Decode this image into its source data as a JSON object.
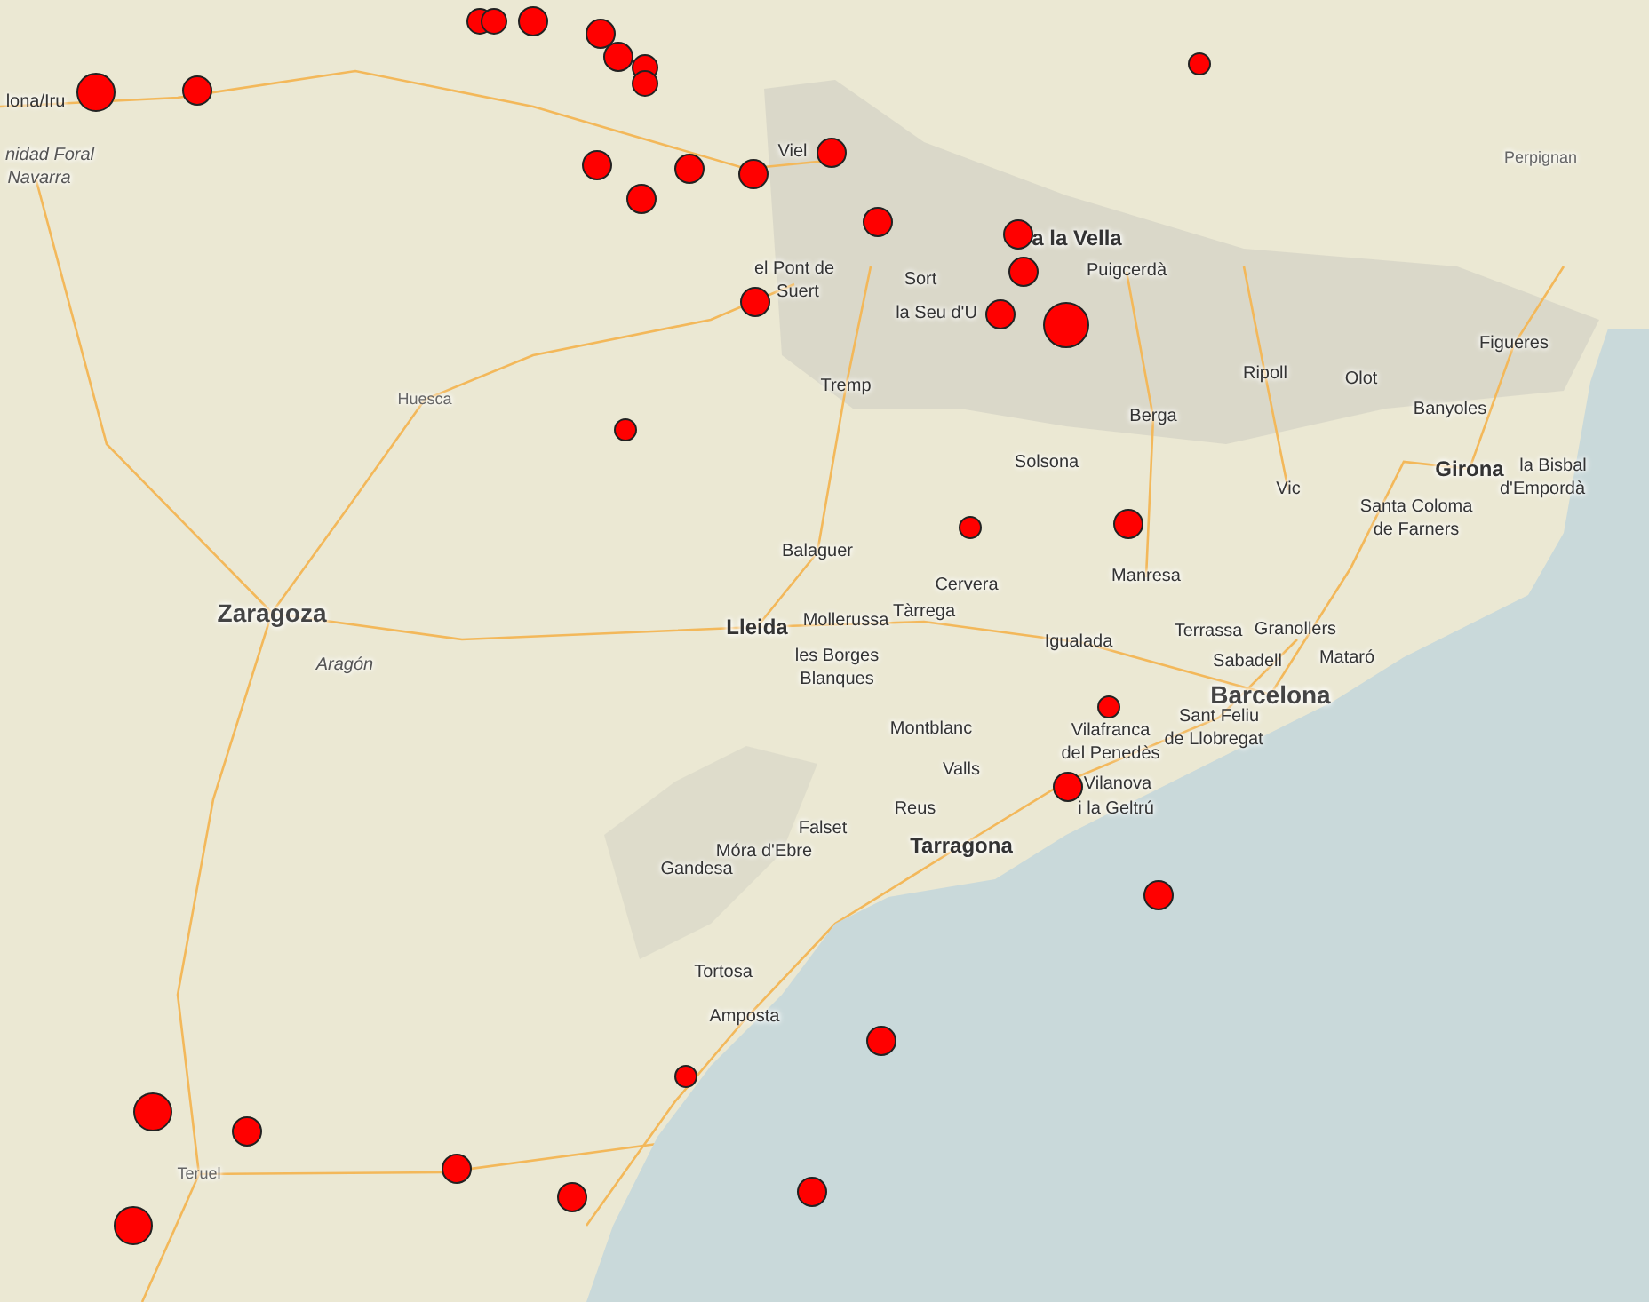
{
  "map": {
    "labels": [
      {
        "text": "lona/Iru",
        "kind": "town"
      },
      {
        "text": "nidad Foral",
        "kind": "region"
      },
      {
        "text": "Navarra",
        "kind": "region"
      },
      {
        "text": "Viel",
        "kind": "town"
      },
      {
        "text": "a la Vella",
        "kind": "city"
      },
      {
        "text": "el Pont de",
        "kind": "town"
      },
      {
        "text": "Suert",
        "kind": "town"
      },
      {
        "text": "Sort",
        "kind": "town"
      },
      {
        "text": "Puigcerdà",
        "kind": "town"
      },
      {
        "text": "la Seu d'U",
        "kind": "town"
      },
      {
        "text": "Perpignan",
        "kind": "faint"
      },
      {
        "text": "Figueres",
        "kind": "town"
      },
      {
        "text": "Tremp",
        "kind": "town"
      },
      {
        "text": "Ripoll",
        "kind": "town"
      },
      {
        "text": "Olot",
        "kind": "town"
      },
      {
        "text": "Banyoles",
        "kind": "town"
      },
      {
        "text": "Huesca",
        "kind": "faint"
      },
      {
        "text": "Berga",
        "kind": "town"
      },
      {
        "text": "Girona",
        "kind": "city"
      },
      {
        "text": "la Bisbal",
        "kind": "town"
      },
      {
        "text": "d'Empordà",
        "kind": "town"
      },
      {
        "text": "Solsona",
        "kind": "town"
      },
      {
        "text": "Vic",
        "kind": "town"
      },
      {
        "text": "Santa Coloma",
        "kind": "town"
      },
      {
        "text": "de Farners",
        "kind": "town"
      },
      {
        "text": "Balaguer",
        "kind": "town"
      },
      {
        "text": "Cervera",
        "kind": "town"
      },
      {
        "text": "Manresa",
        "kind": "town"
      },
      {
        "text": "Zaragoza",
        "kind": "big"
      },
      {
        "text": "Lleida",
        "kind": "city"
      },
      {
        "text": "Mollerussa",
        "kind": "town"
      },
      {
        "text": "Tàrrega",
        "kind": "town"
      },
      {
        "text": "Igualada",
        "kind": "town"
      },
      {
        "text": "Terrassa",
        "kind": "town"
      },
      {
        "text": "Granollers",
        "kind": "town"
      },
      {
        "text": "Aragón",
        "kind": "region"
      },
      {
        "text": "les Borges",
        "kind": "town"
      },
      {
        "text": "Sabadell",
        "kind": "town"
      },
      {
        "text": "Mataró",
        "kind": "town"
      },
      {
        "text": "Blanques",
        "kind": "town"
      },
      {
        "text": "Barcelona",
        "kind": "big"
      },
      {
        "text": "Sant Feliu",
        "kind": "town"
      },
      {
        "text": "de Llobregat",
        "kind": "town"
      },
      {
        "text": "Vilafranca",
        "kind": "town"
      },
      {
        "text": "del Penedès",
        "kind": "town"
      },
      {
        "text": "Montblanc",
        "kind": "town"
      },
      {
        "text": "Valls",
        "kind": "town"
      },
      {
        "text": "Vilanova",
        "kind": "town"
      },
      {
        "text": "i la Geltrú",
        "kind": "town"
      },
      {
        "text": "Reus",
        "kind": "town"
      },
      {
        "text": "Falset",
        "kind": "town"
      },
      {
        "text": "Tarragona",
        "kind": "city"
      },
      {
        "text": "Móra d'Ebre",
        "kind": "town"
      },
      {
        "text": "Gandesa",
        "kind": "town"
      },
      {
        "text": "Tortosa",
        "kind": "town"
      },
      {
        "text": "Amposta",
        "kind": "town"
      },
      {
        "text": "Teruel",
        "kind": "faint"
      }
    ],
    "markers": [
      {
        "kind": "large"
      },
      {
        "kind": "medium"
      },
      {
        "kind": "small"
      },
      {
        "kind": "small"
      },
      {
        "kind": "medium"
      },
      {
        "kind": "medium"
      },
      {
        "kind": "medium"
      },
      {
        "kind": "small"
      },
      {
        "kind": "small"
      },
      {
        "kind": "medium"
      },
      {
        "kind": "medium"
      },
      {
        "kind": "medium"
      },
      {
        "kind": "medium"
      },
      {
        "kind": "medium"
      },
      {
        "kind": "medium"
      },
      {
        "kind": "medium"
      },
      {
        "kind": "medium"
      },
      {
        "kind": "medium"
      },
      {
        "kind": "huge"
      },
      {
        "kind": "tiny"
      },
      {
        "kind": "medium"
      },
      {
        "kind": "tiny"
      },
      {
        "kind": "tiny"
      },
      {
        "kind": "medium"
      },
      {
        "kind": "tiny"
      },
      {
        "kind": "medium"
      },
      {
        "kind": "medium"
      },
      {
        "kind": "medium"
      },
      {
        "kind": "tiny"
      },
      {
        "kind": "large"
      },
      {
        "kind": "medium"
      },
      {
        "kind": "medium"
      },
      {
        "kind": "medium"
      },
      {
        "kind": "medium"
      },
      {
        "kind": "large"
      }
    ]
  }
}
